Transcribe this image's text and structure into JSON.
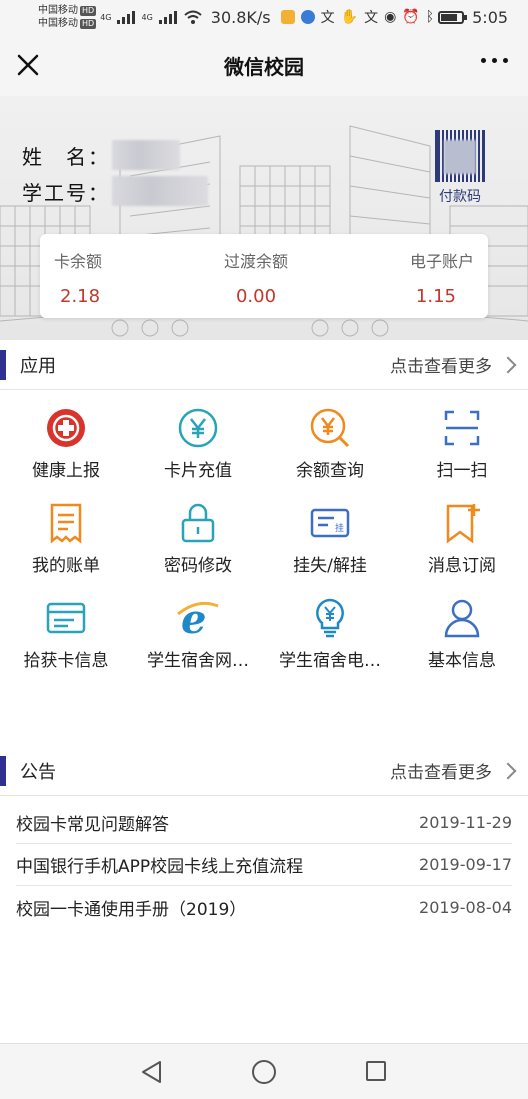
{
  "status_bar": {
    "carrier_1": "中国移动",
    "carrier_2": "中国移动",
    "hd_badge": "HD",
    "net_type": "4G",
    "speed": "30.8K/s",
    "time": "5:05"
  },
  "titlebar": {
    "title": "微信校园"
  },
  "profile": {
    "name_label": "姓　名：",
    "id_label": "学工号：",
    "pay_code_label": "付款码"
  },
  "balances": [
    {
      "label": "卡余额",
      "value": "2.18"
    },
    {
      "label": "过渡余额",
      "value": "0.00"
    },
    {
      "label": "电子账户",
      "value": "1.15"
    }
  ],
  "apps_section": {
    "title": "应用",
    "more": "点击查看更多"
  },
  "apps": [
    {
      "label": "健康上报",
      "icon": "health-cross-icon",
      "color": "#d9342b"
    },
    {
      "label": "卡片充值",
      "icon": "yuan-circle-icon",
      "color": "#29a3b8"
    },
    {
      "label": "余额查询",
      "icon": "yuan-search-icon",
      "color": "#f08a1c"
    },
    {
      "label": "扫一扫",
      "icon": "scan-icon",
      "color": "#3b6fc4"
    },
    {
      "label": "我的账单",
      "icon": "bill-icon",
      "color": "#f08a1c"
    },
    {
      "label": "密码修改",
      "icon": "lock-icon",
      "color": "#29a3b8"
    },
    {
      "label": "挂失/解挂",
      "icon": "card-report-icon",
      "color": "#3b6fc4"
    },
    {
      "label": "消息订阅",
      "icon": "bookmark-plus-icon",
      "color": "#f08a1c"
    },
    {
      "label": "拾获卡信息",
      "icon": "found-card-icon",
      "color": "#29a3b8"
    },
    {
      "label": "学生宿舍网…",
      "icon": "ie-browser-icon",
      "color": "#1e88c9"
    },
    {
      "label": "学生宿舍电…",
      "icon": "lightbulb-yuan-icon",
      "color": "#1e88c9"
    },
    {
      "label": "基本信息",
      "icon": "user-icon",
      "color": "#3b6fc4"
    }
  ],
  "notice_section": {
    "title": "公告",
    "more": "点击查看更多"
  },
  "notices": [
    {
      "title": "校园卡常见问题解答",
      "date": "2019-11-29"
    },
    {
      "title": "中国银行手机APP校园卡线上充值流程",
      "date": "2019-09-17"
    },
    {
      "title": "校园一卡通使用手册（2019）",
      "date": "2019-08-04"
    }
  ],
  "accent_color": "#2e3192",
  "value_color": "#c0392b"
}
